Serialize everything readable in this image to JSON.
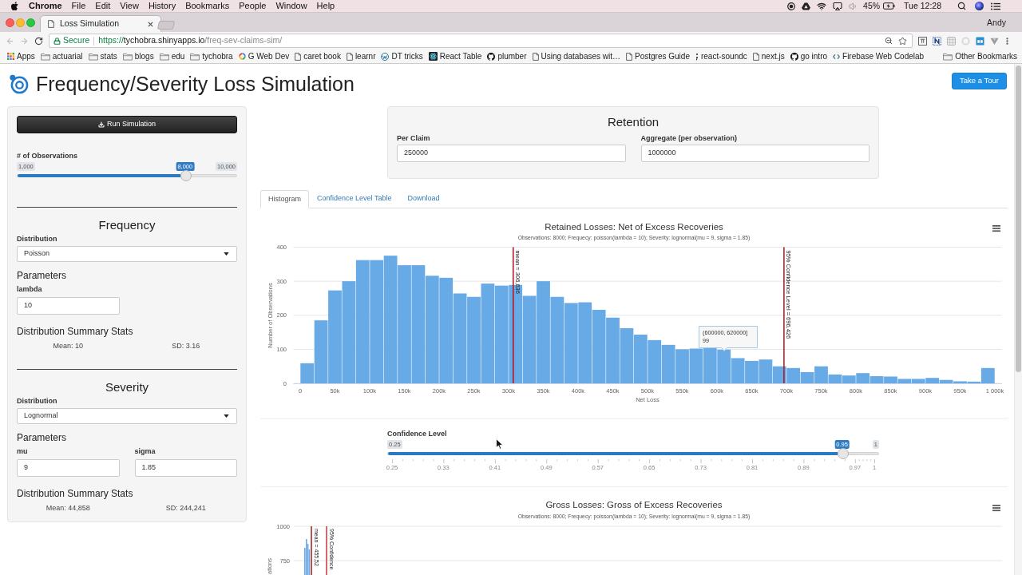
{
  "menu_bar": {
    "app": "Chrome",
    "menus": [
      "File",
      "Edit",
      "View",
      "History",
      "Bookmarks",
      "People",
      "Window",
      "Help"
    ],
    "battery": "45%",
    "clock": "Tue 12:28"
  },
  "browser": {
    "tabs": [
      {
        "title": "Loss Simulation",
        "selected": true
      }
    ],
    "profile": "Andy",
    "address": {
      "security": "Secure",
      "scheme": "https://",
      "host": "tychobra.shinyapps.io",
      "path": "/freq-sev-claims-sim/"
    },
    "bookmarks": [
      {
        "label": "Apps",
        "kind": "apps"
      },
      {
        "label": "actuarial",
        "kind": "folder"
      },
      {
        "label": "stats",
        "kind": "folder"
      },
      {
        "label": "blogs",
        "kind": "folder"
      },
      {
        "label": "edu",
        "kind": "folder"
      },
      {
        "label": "tychobra",
        "kind": "folder"
      },
      {
        "label": "G Web Dev",
        "kind": "ring"
      },
      {
        "label": "caret book",
        "kind": "page"
      },
      {
        "label": "learnr",
        "kind": "page"
      },
      {
        "label": "DT tricks",
        "kind": "disc"
      },
      {
        "label": "React Table",
        "kind": "atom"
      },
      {
        "label": "plumber",
        "kind": "cat"
      },
      {
        "label": "Using databases wit…",
        "kind": "page"
      },
      {
        "label": "Postgres Guide",
        "kind": "page"
      },
      {
        "label": "react-soundc",
        "kind": "dots"
      },
      {
        "label": "next.js",
        "kind": "page"
      },
      {
        "label": "go intro",
        "kind": "cat"
      },
      {
        "label": "Firebase Web Codelab",
        "kind": "code"
      }
    ],
    "other_bookmarks": "Other Bookmarks"
  },
  "page": {
    "title": "Frequency/Severity Loss Simulation",
    "tour_button": "Take a Tour"
  },
  "sidebar": {
    "run_button": "Run Simulation",
    "observations": {
      "label": "# of Observations",
      "min": "1,000",
      "max": "10,000",
      "value": "8,000",
      "level": 0.778
    },
    "sections": [
      {
        "heading": "Frequency",
        "distribution_label": "Distribution",
        "distribution": "Poisson",
        "parameters_heading": "Parameters",
        "parameters": [
          {
            "label": "lambda",
            "value": "10"
          }
        ],
        "stats_heading": "Distribution Summary Stats",
        "stats": [
          "Mean: 10",
          "SD: 3.16"
        ]
      },
      {
        "heading": "Severity",
        "distribution_label": "Distribution",
        "distribution": "Lognormal",
        "parameters_heading": "Parameters",
        "parameters": [
          {
            "label": "mu",
            "value": "9"
          },
          {
            "label": "sigma",
            "value": "1.85"
          }
        ],
        "stats_heading": "Distribution Summary Stats",
        "stats": [
          "Mean: 44,858",
          "SD: 244,241"
        ]
      }
    ]
  },
  "retention": {
    "heading": "Retention",
    "fields": [
      {
        "label": "Per Claim",
        "value": "250000"
      },
      {
        "label": "Aggregate (per observation)",
        "value": "1000000"
      }
    ]
  },
  "tabs": [
    {
      "label": "Histogram",
      "selected": true
    },
    {
      "label": "Confidence Level Table",
      "selected": false
    },
    {
      "label": "Download",
      "selected": false
    }
  ],
  "net_histogram": {
    "chart_data": [
      {
        "type": "histogram",
        "title": "Retained Losses: Net of Excess Recoveries",
        "subtitle": "Observations: 8000; Frequecy: poisson(lambda = 10); Severity: lognormal(mu = 9, sigma = 1.85)",
        "xlabel": "Net Loss",
        "ylabel": "Number of Observations",
        "bins": [
          0,
          20000,
          40000,
          60000,
          80000,
          100000,
          120000,
          140000,
          160000,
          180000,
          200000,
          220000,
          240000,
          260000,
          280000,
          300000,
          320000,
          340000,
          360000,
          380000,
          400000,
          420000,
          440000,
          460000,
          480000,
          500000,
          520000,
          540000,
          560000,
          580000,
          600000,
          620000,
          640000,
          660000,
          680000,
          700000,
          720000,
          740000,
          760000,
          780000,
          800000,
          820000,
          840000,
          860000,
          880000,
          900000,
          920000,
          940000,
          960000,
          980000,
          1000000
        ],
        "values": [
          59,
          185,
          273,
          300,
          362,
          362,
          375,
          347,
          347,
          316,
          310,
          264,
          254,
          293,
          287,
          289,
          257,
          300,
          254,
          236,
          238,
          216,
          193,
          162,
          143,
          127,
          113,
          100,
          102,
          107,
          99,
          74,
          66,
          70,
          50,
          45,
          33,
          50,
          26,
          23,
          30,
          21,
          20,
          13,
          13,
          16,
          10,
          6,
          5,
          45
        ],
        "color": "#67aae6",
        "xlim": [
          -10000,
          1010000
        ],
        "ylim": [
          0,
          400
        ],
        "xticks": [
          {
            "value": 0,
            "label": "0"
          },
          {
            "value": 50000,
            "label": "50k"
          },
          {
            "value": 100000,
            "label": "100k"
          },
          {
            "value": 150000,
            "label": "150k"
          },
          {
            "value": 200000,
            "label": "200k"
          },
          {
            "value": 250000,
            "label": "250k"
          },
          {
            "value": 300000,
            "label": "300k"
          },
          {
            "value": 350000,
            "label": "350k"
          },
          {
            "value": 400000,
            "label": "400k"
          },
          {
            "value": 450000,
            "label": "450k"
          },
          {
            "value": 500000,
            "label": "500k"
          },
          {
            "value": 550000,
            "label": "550k"
          },
          {
            "value": 600000,
            "label": "600k"
          },
          {
            "value": 650000,
            "label": "650k"
          },
          {
            "value": 700000,
            "label": "700k"
          },
          {
            "value": 750000,
            "label": "750k"
          },
          {
            "value": 800000,
            "label": "800k"
          },
          {
            "value": 850000,
            "label": "850k"
          },
          {
            "value": 900000,
            "label": "900k"
          },
          {
            "value": 950000,
            "label": "950k"
          },
          {
            "value": 1000000,
            "label": "1 000k"
          }
        ],
        "yticks": [
          0,
          100,
          200,
          300,
          400
        ],
        "grid": true,
        "ref_lines": [
          {
            "axis": "x",
            "value": 306636,
            "label": "mean = 306,636",
            "color": "#b3121b"
          },
          {
            "axis": "x",
            "value": 696426,
            "label": "95% Confidence Level = 696,426",
            "color": "#b3121b"
          }
        ]
      }
    ],
    "tooltip": {
      "range": "(600000, 620000]",
      "value": "99"
    }
  },
  "confidence": {
    "label": "Confidence Level",
    "min": "0.25",
    "max": "1",
    "value": "0.95",
    "level": 0.933,
    "ticks": [
      "0.25",
      "0.33",
      "0.41",
      "0.49",
      "0.57",
      "0.65",
      "0.73",
      "0.81",
      "0.89",
      "0.97",
      "1"
    ]
  },
  "gross_histogram": {
    "title": "Gross Losses: Gross of Excess Recoveries",
    "subtitle": "Observations: 8000; Frequecy: poisson(lambda = 10); Severity: lognormal(mu = 9, sigma = 1.85)",
    "ylabel": "ations",
    "ytick_labels": [
      "1000",
      "750"
    ],
    "line_labels": [
      "mean = 455,52",
      "95% Confidence"
    ]
  }
}
